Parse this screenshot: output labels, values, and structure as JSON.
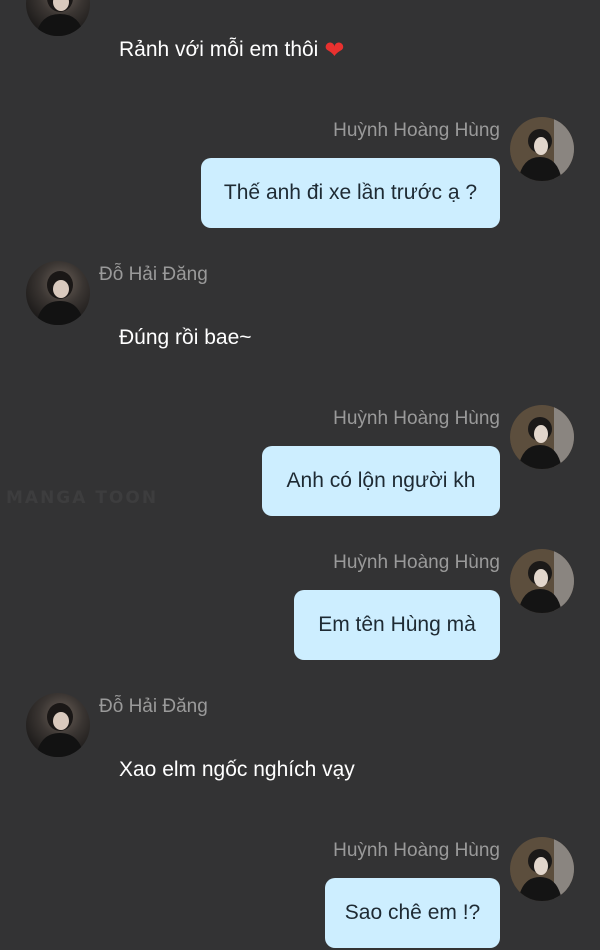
{
  "watermark": "MANGA TOON",
  "messages": [
    {
      "side": "left",
      "text": "Rảnh với mỗi em thôi",
      "emoji": "❤",
      "emoji_icon": "heart-icon"
    },
    {
      "side": "right",
      "sender": "Huỳnh Hoàng Hùng",
      "text": "Thế anh đi xe lần trước ạ ?"
    },
    {
      "side": "left",
      "sender": "Đỗ Hải Đăng",
      "text": "Đúng rồi bae~"
    },
    {
      "side": "right",
      "sender": "Huỳnh Hoàng Hùng",
      "text": "Anh có lộn người kh"
    },
    {
      "side": "right",
      "sender": "Huỳnh Hoàng Hùng",
      "text": "Em tên Hùng mà"
    },
    {
      "side": "left",
      "sender": "Đỗ Hải Đăng",
      "text": "Xao elm ngốc nghích vạy"
    },
    {
      "side": "right",
      "sender": "Huỳnh Hoàng Hùng",
      "text": "Sao chê em !?"
    }
  ],
  "colors": {
    "background": "#333334",
    "bubble": "#cdeeff",
    "sender_name": "#9a9a9a",
    "left_text": "#ffffff",
    "heart": "#e8312f"
  }
}
